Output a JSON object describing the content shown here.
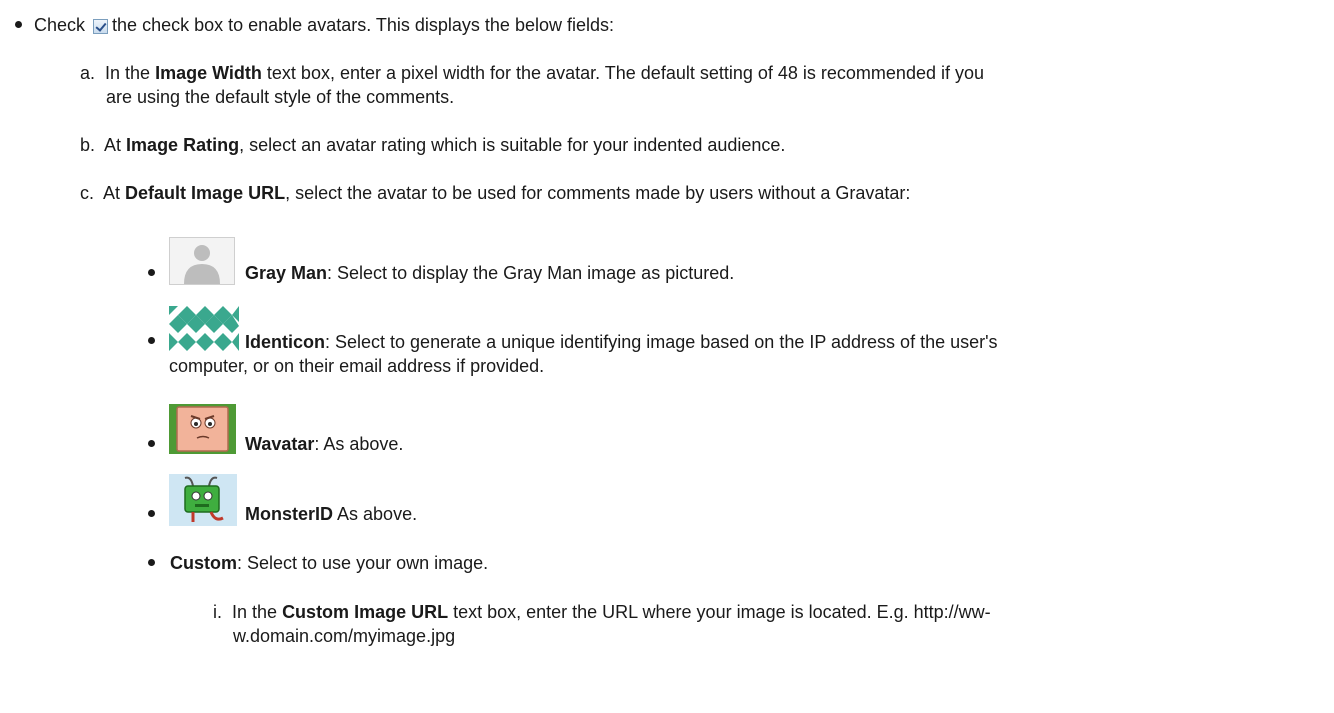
{
  "intro": {
    "prefix": "Check",
    "suffix": "the check box to enable avatars. This displays the below fields:"
  },
  "items": {
    "a": {
      "marker": "a.",
      "t1": "In the ",
      "b1": "Image Width",
      "t2": " text box, enter a pixel width for the avatar. The default setting of 48 is recommended if you",
      "line2": "are using the default style of the comments."
    },
    "b": {
      "marker": "b.",
      "t1": "At ",
      "b1": "Image Rating",
      "t2": ", select an avatar rating which is suitable for your indented audience."
    },
    "c": {
      "marker": "c.",
      "t1": "At ",
      "b1": "Default Image URL",
      "t2": ", select the avatar to be used for comments made by users without a Gravatar:"
    }
  },
  "avatars": [
    {
      "name": "Gray Man",
      "icon": "gray-man-icon",
      "desc": ": Select to display the Gray Man image as pictured."
    },
    {
      "name": "Identicon",
      "icon": "identicon-icon",
      "desc": ": Select to generate a unique identifying image based on the IP address of the user's",
      "line2": "computer, or on their email address if provided."
    },
    {
      "name": "Wavatar",
      "icon": "wavatar-icon",
      "desc": ": As above."
    },
    {
      "name": "MonsterID",
      "icon": "monsterid-icon",
      "desc": " As above."
    },
    {
      "name": "Custom",
      "desc": ": Select to use your own image."
    }
  ],
  "custom": {
    "marker": "i.",
    "t1": "In the ",
    "b1": "Custom Image URL",
    "t2": " text box, enter the URL where your image is located. E.g. http://ww-",
    "line2": "w.domain.com/myimage.jpg"
  },
  "colors": {
    "text": "#1a1a1a",
    "checkbox_border": "#7b9ebd",
    "identicon": "#3aa88e"
  }
}
